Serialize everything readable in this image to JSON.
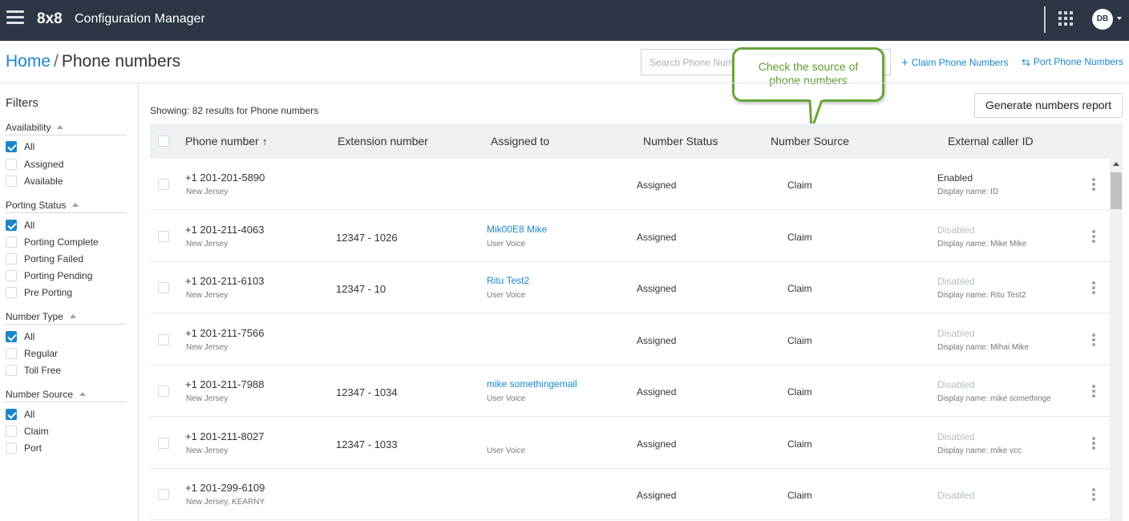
{
  "topbar": {
    "logo": "8x8",
    "app_title": "Configuration Manager",
    "avatar_initials": "DB",
    "icons": [
      "hamburger-menu-icon",
      "apps-grid-icon",
      "chevron-down-icon"
    ]
  },
  "breadcrumb": {
    "home": "Home",
    "separator": "/",
    "current": "Phone numbers"
  },
  "search": {
    "placeholder": "Search Phone Numbers"
  },
  "actions": {
    "claim": {
      "icon": "+",
      "label": "Claim Phone Numbers"
    },
    "port": {
      "icon": "⇆",
      "label": "Port Phone Numbers"
    }
  },
  "callout": {
    "line1": "Check the source of",
    "line2": "phone numbers"
  },
  "filters": {
    "title": "Filters",
    "groups": [
      {
        "title": "Availability",
        "options": [
          {
            "label": "All",
            "checked": true
          },
          {
            "label": "Assigned",
            "checked": false
          },
          {
            "label": "Available",
            "checked": false
          }
        ]
      },
      {
        "title": "Porting Status",
        "options": [
          {
            "label": "All",
            "checked": true
          },
          {
            "label": "Porting Complete",
            "checked": false
          },
          {
            "label": "Porting Failed",
            "checked": false
          },
          {
            "label": "Porting Pending",
            "checked": false
          },
          {
            "label": "Pre Porting",
            "checked": false
          }
        ]
      },
      {
        "title": "Number Type",
        "options": [
          {
            "label": "All",
            "checked": true
          },
          {
            "label": "Regular",
            "checked": false
          },
          {
            "label": "Toll Free",
            "checked": false
          }
        ]
      },
      {
        "title": "Number Source",
        "options": [
          {
            "label": "All",
            "checked": true
          },
          {
            "label": "Claim",
            "checked": false
          },
          {
            "label": "Port",
            "checked": false
          }
        ]
      }
    ]
  },
  "results": {
    "showing": "Showing: 82 results for Phone numbers"
  },
  "report_button": "Generate numbers report",
  "table": {
    "columns": {
      "phone": "Phone number",
      "sort_icon": "↑",
      "extension": "Extension number",
      "assigned": "Assigned to",
      "status": "Number Status",
      "source": "Number Source",
      "caller_id": "External caller ID"
    },
    "rows": [
      {
        "phone": "+1 201-201-5890",
        "location": "New Jersey",
        "extension": "",
        "assigned_name": "",
        "assigned_type": "",
        "status": "Assigned",
        "source": "Claim",
        "caller_status": "Enabled",
        "caller_enabled": true,
        "display_name": "Display name: ID"
      },
      {
        "phone": "+1 201-211-4063",
        "location": "New Jersey",
        "extension": "12347 - 1026",
        "assigned_name": "Mik00E8 Mike",
        "assigned_type": "User Voice",
        "status": "Assigned",
        "source": "Claim",
        "caller_status": "Disabled",
        "caller_enabled": false,
        "display_name": "Display name: Mike Mike"
      },
      {
        "phone": "+1 201-211-6103",
        "location": "New Jersey",
        "extension": "12347 - 10",
        "assigned_name": "Ritu Test2",
        "assigned_type": "User Voice",
        "status": "Assigned",
        "source": "Claim",
        "caller_status": "Disabled",
        "caller_enabled": false,
        "display_name": "Display name: Ritu Test2"
      },
      {
        "phone": "+1 201-211-7566",
        "location": "New Jersey",
        "extension": "",
        "assigned_name": "",
        "assigned_type": "",
        "status": "Assigned",
        "source": "Claim",
        "caller_status": "Disabled",
        "caller_enabled": false,
        "display_name": "Display name: Mihai Mike"
      },
      {
        "phone": "+1 201-211-7988",
        "location": "New Jersey",
        "extension": "12347 - 1034",
        "assigned_name": "mike somethingemail",
        "assigned_type": "User Voice",
        "status": "Assigned",
        "source": "Claim",
        "caller_status": "Disabled",
        "caller_enabled": false,
        "display_name": "Display name: mike somethinge"
      },
      {
        "phone": "+1 201-211-8027",
        "location": "New Jersey",
        "extension": "12347 - 1033",
        "assigned_name": "",
        "assigned_type": "User Voice",
        "status": "Assigned",
        "source": "Claim",
        "caller_status": "Disabled",
        "caller_enabled": false,
        "display_name": "Display name: mike vcc"
      },
      {
        "phone": "+1 201-299-6109",
        "location": "New Jersey, KEARNY",
        "extension": "",
        "assigned_name": "",
        "assigned_type": "",
        "status": "Assigned",
        "source": "Claim",
        "caller_status": "Disabled",
        "caller_enabled": false,
        "display_name": ""
      }
    ]
  },
  "colors": {
    "topbar": "#2c3644",
    "accent": "#1a87c9",
    "callout_green": "#6aa53a",
    "header_bg": "#eef1f4"
  }
}
